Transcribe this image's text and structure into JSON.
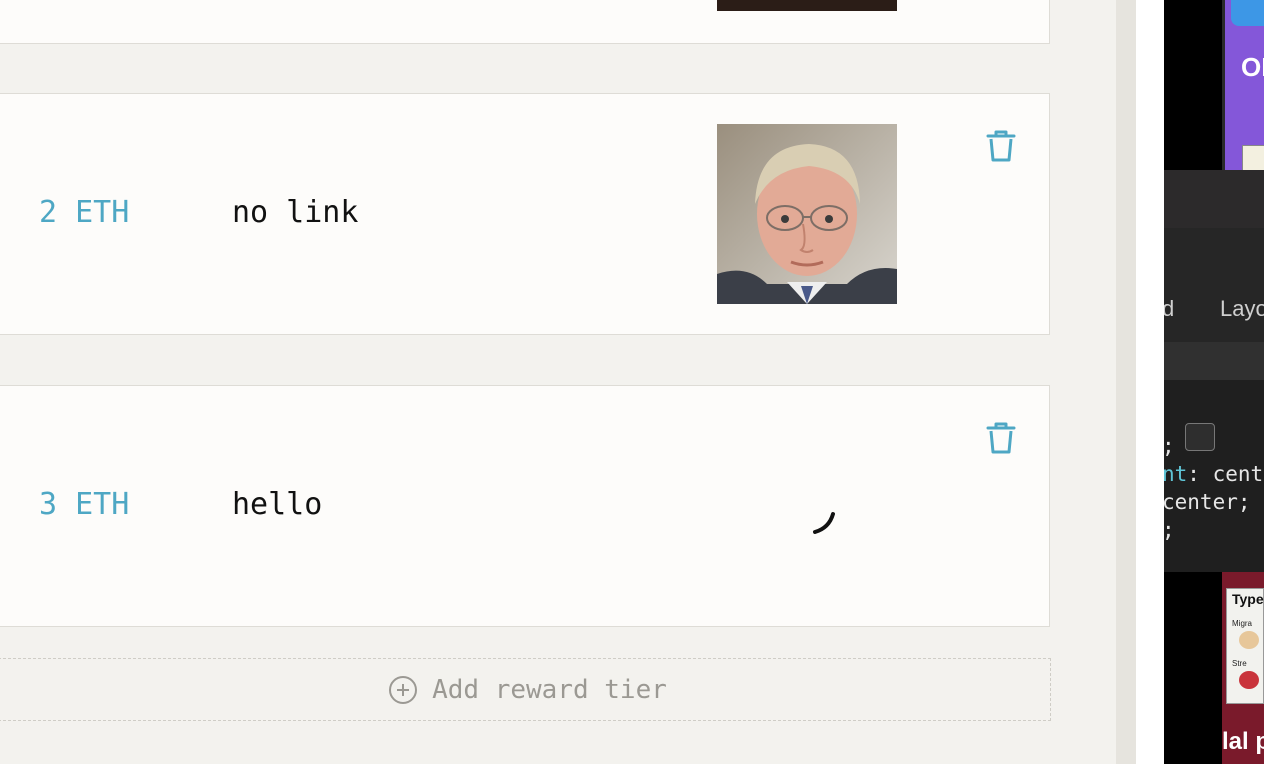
{
  "rewards": {
    "tiers": [
      {
        "price": "2 ETH",
        "link": "no link"
      },
      {
        "price": "3 ETH",
        "link": "hello"
      }
    ],
    "add_label": "Add reward tier"
  },
  "side": {
    "purple_text": "OI",
    "devtools_tabs": [
      "d",
      "Layo"
    ],
    "css_lines": [
      {
        "prefix": ";",
        "key": "",
        "value": ""
      },
      {
        "prefix": "",
        "key": "nt",
        "value": ": cent"
      },
      {
        "prefix": "",
        "key": "",
        "value": "center;"
      },
      {
        "prefix": "",
        "key": "",
        "value": ";"
      }
    ],
    "sheet_title": "Type",
    "sheet_line1": "Migra",
    "sheet_line2": "Stre",
    "bottom_caption": "lal p"
  },
  "colors": {
    "accent": "#4ea7c4",
    "card": "#fdfcfa",
    "page": "#f3f2ee"
  }
}
